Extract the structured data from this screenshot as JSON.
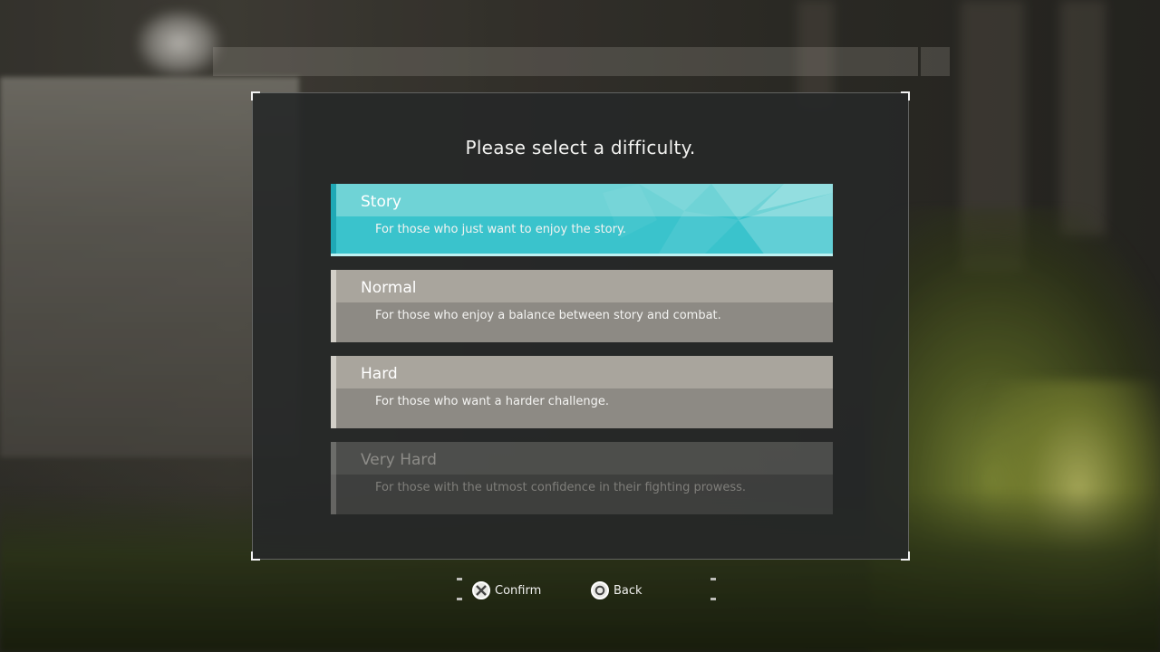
{
  "dialog": {
    "title": "Please select a difficulty."
  },
  "difficulties": [
    {
      "label": "Story",
      "description": "For those who just want to enjoy the story.",
      "state": "selected"
    },
    {
      "label": "Normal",
      "description": "For those who enjoy a balance between story and combat.",
      "state": "normal"
    },
    {
      "label": "Hard",
      "description": "For those who want a harder challenge.",
      "state": "normal"
    },
    {
      "label": "Very Hard",
      "description": "For those with the utmost confidence in their fighting prowess.",
      "state": "disabled"
    }
  ],
  "footer": {
    "confirm": {
      "icon": "cross-button-icon",
      "label": "Confirm"
    },
    "back": {
      "icon": "circle-button-icon",
      "label": "Back"
    }
  },
  "colors": {
    "selected_top": "#6fd3d6",
    "selected_bottom": "#3ac3cc",
    "option_top": "#a9a59d",
    "option_bottom": "#8d8a84",
    "dialog_bg": "#262828"
  }
}
